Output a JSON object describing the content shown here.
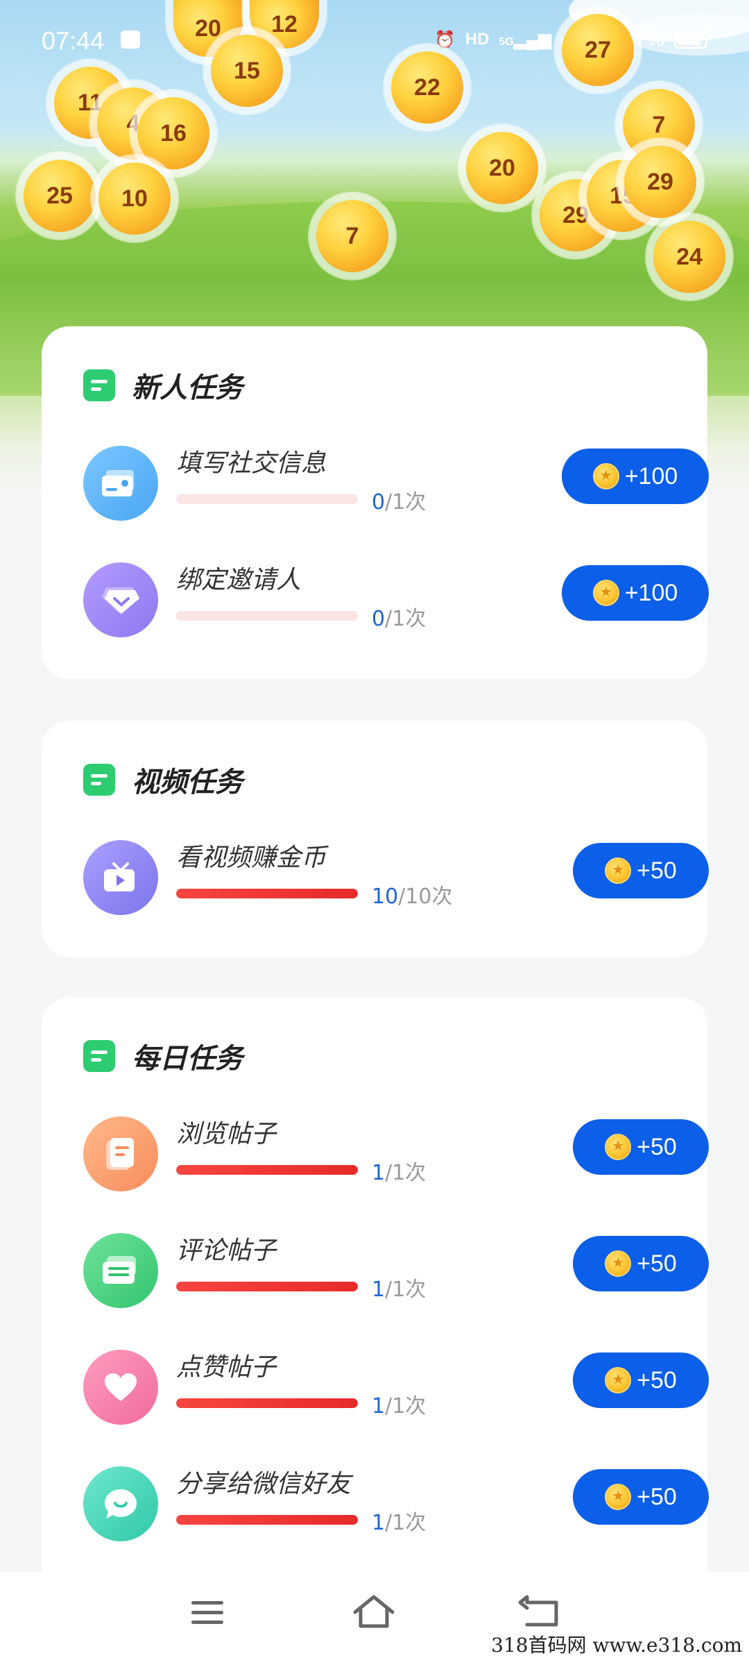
{
  "status_bar": {
    "time": "07:44",
    "hd_label": "HD",
    "net_1": "5G",
    "net_2": "5G",
    "battery": "87%",
    "battery_level": 0.87
  },
  "coins": [
    {
      "value": "20"
    },
    {
      "value": "12"
    },
    {
      "value": "15"
    },
    {
      "value": "11"
    },
    {
      "value": "4"
    },
    {
      "value": "16"
    },
    {
      "value": "25"
    },
    {
      "value": "10"
    },
    {
      "value": "7"
    },
    {
      "value": "22"
    },
    {
      "value": "20"
    },
    {
      "value": "27"
    },
    {
      "value": "7"
    },
    {
      "value": "29"
    },
    {
      "value": "15"
    },
    {
      "value": "29"
    },
    {
      "value": "24"
    }
  ],
  "sections": {
    "newbie": {
      "title": "新人任务",
      "tasks": [
        {
          "name": "填写社交信息",
          "done": "0",
          "total": "/1次",
          "reward": "+100",
          "progress": 0
        },
        {
          "name": "绑定邀请人",
          "done": "0",
          "total": "/1次",
          "reward": "+100",
          "progress": 0
        }
      ]
    },
    "video": {
      "title": "视频任务",
      "tasks": [
        {
          "name": "看视频赚金币",
          "done": "10",
          "total": "/10次",
          "reward": "+50",
          "progress": 1
        }
      ]
    },
    "daily": {
      "title": "每日任务",
      "tasks": [
        {
          "name": "浏览帖子",
          "done": "1",
          "total": "/1次",
          "reward": "+50",
          "progress": 1
        },
        {
          "name": "评论帖子",
          "done": "1",
          "total": "/1次",
          "reward": "+50",
          "progress": 1
        },
        {
          "name": "点赞帖子",
          "done": "1",
          "total": "/1次",
          "reward": "+50",
          "progress": 1
        },
        {
          "name": "分享给微信好友",
          "done": "1",
          "total": "/1次",
          "reward": "+50",
          "progress": 1
        }
      ]
    }
  },
  "watermark": "318首码网 www.e318.com",
  "colors": {
    "reward_button": "#0b5fe8",
    "progress_fill": "#f8453f",
    "badge": "#2ecc71"
  }
}
